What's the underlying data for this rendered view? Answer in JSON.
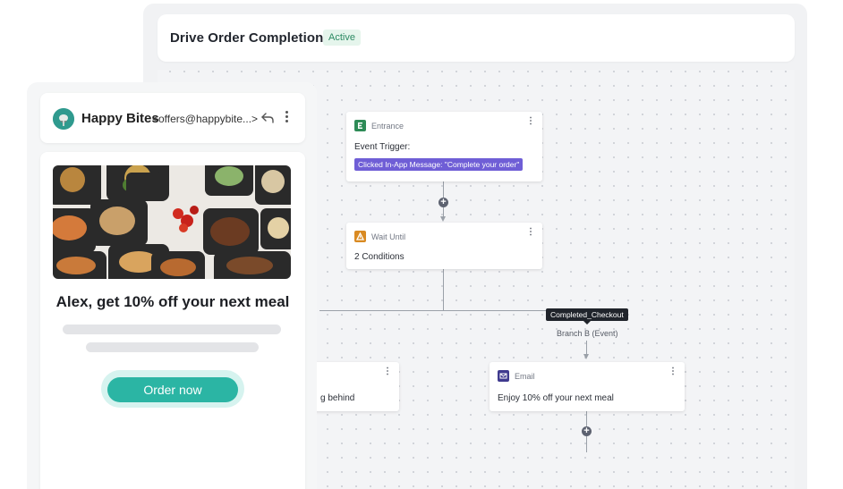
{
  "workflow": {
    "title": "Drive Order Completion",
    "status": "Active",
    "nodes": {
      "entrance": {
        "type": "Entrance",
        "label": "Event Trigger:",
        "chip": "Clicked In-App Message: \"Complete your order\"",
        "menu": "⋮"
      },
      "wait": {
        "type": "Wait Until",
        "label": "2 Conditions",
        "menu": "⋮"
      },
      "left_branch": {
        "label": "g behind",
        "menu": "⋮"
      },
      "email": {
        "type": "Email",
        "label": "Enjoy 10% off your next meal",
        "menu": "⋮"
      }
    },
    "tooltip": "Completed_Checkout",
    "branch_label": "Branch B (Event)"
  },
  "email_preview": {
    "sender_name": "Happy Bites",
    "sender_email": "<offers@happybite...>",
    "headline": "Alex, get 10% off your next meal",
    "cta_label": "Order now"
  },
  "icons": {
    "entrance": "entrance-icon",
    "wait": "wait-icon",
    "email": "email-icon",
    "reply": "reply-icon",
    "more": "more-vertical-icon",
    "avatar": "avatar"
  },
  "colors": {
    "accent_teal": "#2bb5a4",
    "chip_purple": "#6f5ed6",
    "status_green": "#2c8a63",
    "entrance_green": "#2e8b57",
    "wait_orange": "#d98a22",
    "email_indigo": "#3f3a8e"
  }
}
